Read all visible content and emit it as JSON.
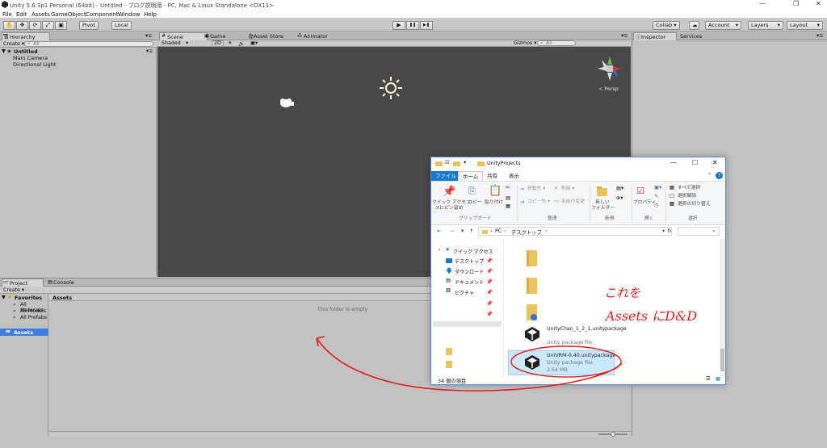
{
  "window": {
    "title": "Unity 5.6.3p1 Personal (64bit) - Untitled - ブログ説明用 - PC, Mac & Linux Standalone <DX11>",
    "controls": [
      "—",
      "❐",
      "✕"
    ]
  },
  "menu": [
    "File",
    "Edit",
    "Assets",
    "GameObject",
    "Component",
    "Window",
    "Help"
  ],
  "toolbar": {
    "pivot": "Pivot",
    "local": "Local",
    "play": "▶",
    "pause": "❚❚",
    "step": "▶❚",
    "collab": "Collab ▾",
    "account": "Account",
    "layers": "Layers",
    "layout": "Layout"
  },
  "hierarchy": {
    "tab": "Hierarchy",
    "create": "Create ▾",
    "search": "All",
    "scene": "Untitled",
    "items": [
      "Main Camera",
      "Directional Light"
    ]
  },
  "scene": {
    "tabs": [
      "Scene",
      "Game",
      "Asset Store",
      "Animator"
    ],
    "shading": "Shaded",
    "mode2d": "2D",
    "gizmos": "Gizmos ▾",
    "search": "All",
    "persp": "< Persp"
  },
  "inspector": {
    "tabs": [
      "Inspector",
      "Services"
    ]
  },
  "project": {
    "tabs": [
      "Project",
      "Console"
    ],
    "create": "Create ▾",
    "favorites": "Favorites",
    "fav_items": [
      "All Materials",
      "All Models",
      "All Prefabs"
    ],
    "assets": "Assets",
    "assets_header": "Assets",
    "empty": "This folder is empty"
  },
  "explorer": {
    "title": "UnityProjects",
    "tabs": [
      "ファイル",
      "ホーム",
      "共有",
      "表示"
    ],
    "ribbon": {
      "quick": "クイック アクセス\nスにピン留め",
      "copy": "コピー",
      "paste": "貼り付け",
      "group1": "クリップボード",
      "move": "移動先 ▾",
      "copyto": "コピー先 ▾",
      "delete": "削除 ▾",
      "rename": "名前の変更",
      "group2": "整理",
      "newfolder": "新しい\nフォルダー",
      "group3": "新規",
      "props": "プロパティ",
      "group4": "開く",
      "selall": "すべて選択",
      "selnone": "選択解除",
      "selinv": "選択の切り替え",
      "group5": "選択"
    },
    "path": [
      "PC",
      "デスクトップ"
    ],
    "nav": [
      "クイック アクセス",
      "デスクトップ",
      "ダウンロード",
      "ドキュメント",
      "ピクチャ"
    ],
    "files": [
      {
        "name": "UnityChan_1_2_1.unitypackage",
        "type": "Unity package file"
      },
      {
        "name": "UniVRM-0.40.unitypackage",
        "type": "Unity package file",
        "size": "2.64 MB"
      }
    ],
    "status": "34 個の項目"
  },
  "annotation": {
    "line1": "これを",
    "line2": "Assets にD&D"
  }
}
